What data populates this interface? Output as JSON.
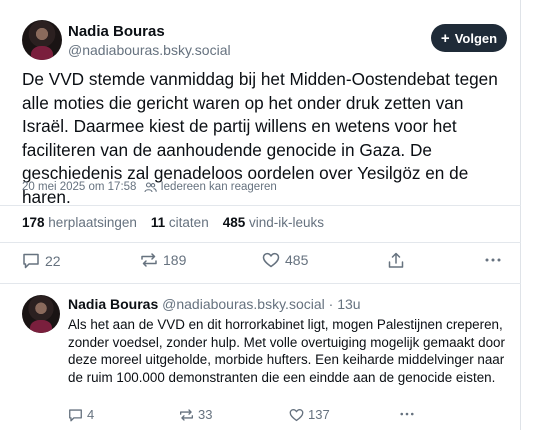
{
  "post": {
    "author_name": "Nadia Bouras",
    "author_handle": "@nadiabouras.bsky.social",
    "follow_label": "Volgen",
    "text": "De VVD stemde vanmiddag bij het Midden-Oostendebat tegen alle moties die gericht waren op het onder druk zetten van Israël. Daarmee kiest de partij willens en wetens voor het faciliteren van de aanhoudende genocide in Gaza. De geschiedenis zal genadeloos oordelen over Yesilgöz en de haren.",
    "timestamp": "20 mei 2025 om 17:58",
    "reply_setting": "Iedereen kan reageren",
    "stats": {
      "reposts_count": "178",
      "reposts_label": "herplaatsingen",
      "quotes_count": "11",
      "quotes_label": "citaten",
      "likes_count": "485",
      "likes_label": "vind-ik-leuks"
    },
    "actions": {
      "replies": "22",
      "reposts": "189",
      "likes": "485"
    }
  },
  "reply": {
    "author_name": "Nadia Bouras",
    "author_handle": "@nadiabouras.bsky.social",
    "time_ago": "13u",
    "text": "Als het aan de VVD en dit horrorkabinet ligt, mogen Palestijnen creperen, zonder voedsel, zonder hulp. Met volle overtuiging mogelijk gemaakt door deze moreel uitgeholde, morbide hufters. Een keiharde middelvinger naar de ruim 100.000 demonstranten die een eindde aan de genocide eisten.",
    "actions": {
      "replies": "4",
      "reposts": "33",
      "likes": "137"
    }
  },
  "icons": {
    "reply": "speech-bubble-icon",
    "repost": "repost-arrows-icon",
    "like": "heart-icon",
    "share": "share-icon",
    "more": "more-dots-icon",
    "people": "people-icon",
    "plus": "plus-icon"
  },
  "colors": {
    "text": "#0b0f14",
    "muted": "#66727f",
    "follow_button_bg": "#1f2b38",
    "divider": "#e3e7ec"
  }
}
